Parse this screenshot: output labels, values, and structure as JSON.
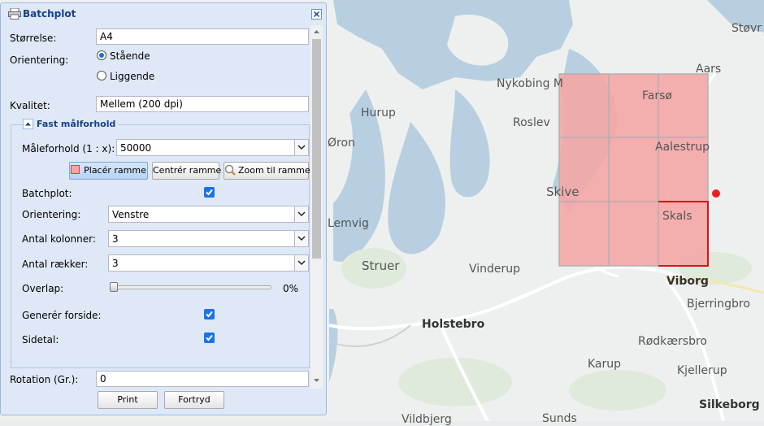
{
  "panel": {
    "title": "Batchplot",
    "size_label": "Størrelse:",
    "size_value": "A4",
    "orientation_label": "Orientering:",
    "orientation_options": [
      "Stående",
      "Liggende"
    ],
    "orientation_selected": "Stående",
    "quality_label": "Kvalitet:",
    "quality_value": "Mellem (200 dpi)",
    "fixed_scale_title": "Fast målforhold",
    "scale_label": "Måleforhold (1 : x):",
    "scale_value": "50000",
    "btn_place": "Placér ramme",
    "btn_center": "Centrér ramme",
    "btn_zoom": "Zoom til ramme",
    "batchplot_label": "Batchplot:",
    "batchplot_checked": true,
    "batch_orientation_label": "Orientering:",
    "batch_orientation_value": "Venstre",
    "columns_label": "Antal kolonner:",
    "columns_value": "3",
    "rows_label": "Antal rækker:",
    "rows_value": "3",
    "overlap_label": "Overlap:",
    "overlap_value": "0%",
    "overlap_fraction": 0,
    "cover_label": "Generér forside:",
    "cover_checked": true,
    "pagenum_label": "Sidetal:",
    "pagenum_checked": true,
    "rotation_label": "Rotation (Gr.):",
    "rotation_value": "0",
    "btn_print": "Print",
    "btn_cancel": "Fortryd"
  },
  "map": {
    "labels": {
      "stovring": "Støvr",
      "aars": "Aars",
      "nykobing": "Nykobing M",
      "farso": "Farsø",
      "hurup": "Hurup",
      "roslev": "Roslev",
      "aalestrup": "Aalestrup",
      "skive": "Skive",
      "skals": "Skals",
      "lemvig": "Lemvig",
      "struer": "Struer",
      "vinderup": "Vinderup",
      "viborg": "Viborg",
      "bjerringbro": "Bjerringbro",
      "holstebro": "Holstebro",
      "rodkaersbro": "Rødkærsbro",
      "karup": "Karup",
      "kjellerup": "Kjellerup",
      "silkeborg": "Silkeborg",
      "vildbjerg": "Vildbjerg",
      "sunds": "Sunds",
      "thisted_part": "rup",
      "nor_part": "Øron"
    },
    "colors": {
      "water": "#b4cde0",
      "land": "#eef0f0",
      "grid_fill": "#f4a6a6",
      "grid_line": "#b0b0b0",
      "active_frame": "#e01010"
    }
  }
}
